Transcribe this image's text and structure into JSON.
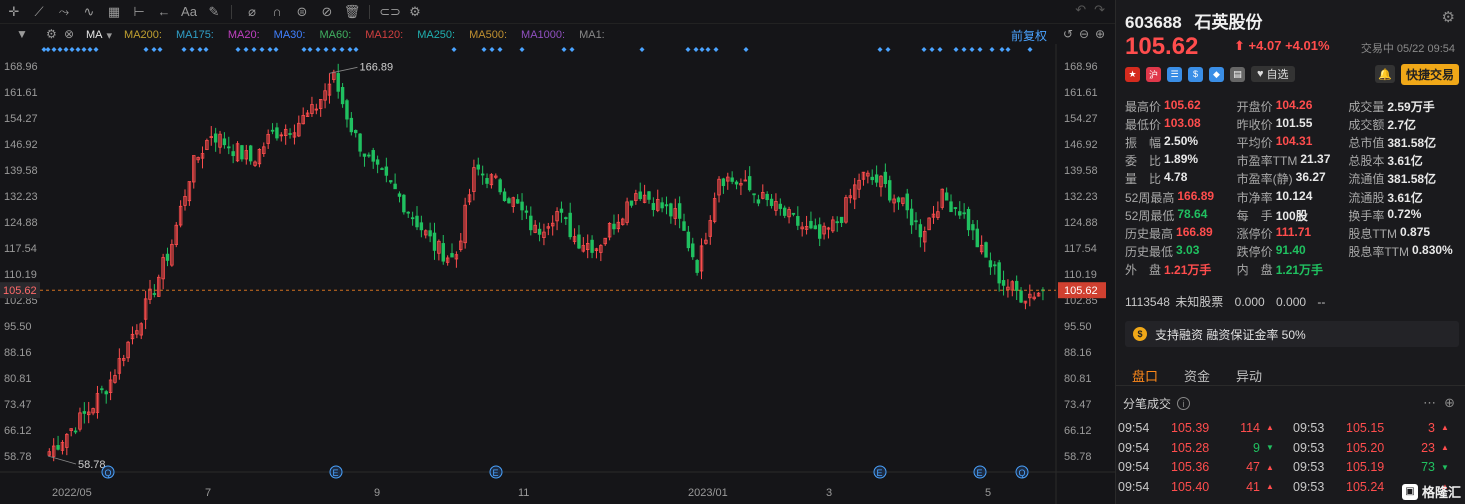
{
  "chart": {
    "fuquan_label": "前复权",
    "ma_selector": "MA",
    "ma_lines": [
      {
        "label": "MA200:",
        "color": "#c0a030"
      },
      {
        "label": "MA175:",
        "color": "#30a0c8"
      },
      {
        "label": "MA20:",
        "color": "#c040c0"
      },
      {
        "label": "MA30:",
        "color": "#4080ff"
      },
      {
        "label": "MA60:",
        "color": "#40b060"
      },
      {
        "label": "MA120:",
        "color": "#d04040"
      },
      {
        "label": "MA250:",
        "color": "#20b0b0"
      },
      {
        "label": "MA500:",
        "color": "#c09030"
      },
      {
        "label": "MA1000:",
        "color": "#9050c0"
      },
      {
        "label": "MA1:",
        "color": "#888888"
      }
    ],
    "y_ticks": [
      "168.96",
      "161.61",
      "154.27",
      "146.92",
      "139.58",
      "132.23",
      "124.88",
      "117.54",
      "110.19",
      "102.85",
      "95.50",
      "88.16",
      "80.81",
      "73.47",
      "66.12",
      "58.78"
    ],
    "current_price_tag": "105.62",
    "x_ticks": [
      "2022/05",
      "7",
      "9",
      "11",
      "2023/01",
      "3",
      "5"
    ],
    "high_label": "166.89",
    "low_label": "58.78",
    "event_markers": [
      "Q",
      "E",
      "E",
      "E",
      "E",
      "Q"
    ]
  },
  "chart_data": {
    "type": "candlestick",
    "ylim": [
      58.78,
      168.96
    ],
    "last_price": 105.62,
    "high": 166.89,
    "low": 58.78,
    "closes_weekly_approx": [
      60,
      66,
      72,
      80,
      92,
      104,
      118,
      140,
      150,
      146,
      142,
      150,
      152,
      156,
      166,
      150,
      140,
      134,
      126,
      118,
      114,
      140,
      136,
      130,
      122,
      128,
      120,
      118,
      126,
      134,
      130,
      126,
      112,
      138,
      136,
      132,
      128,
      124,
      120,
      126,
      138,
      136,
      130,
      122,
      132,
      128,
      116,
      108,
      104,
      105.62
    ]
  },
  "quote": {
    "code": "603688",
    "name": "石英股份",
    "price": "105.62",
    "arrow": "⬆",
    "change": "+4.07",
    "change_pct": "+4.01%",
    "time": "交易中 05/22 09:54",
    "watch_label": "自选",
    "quick_trade": "快捷交易",
    "badges": [
      {
        "text": "★",
        "color": "#d52b1e"
      },
      {
        "text": "沪",
        "color": "#e0384a"
      },
      {
        "text": "☰",
        "color": "#3a8ee6"
      },
      {
        "text": "$",
        "color": "#3a8ee6"
      },
      {
        "text": "◆",
        "color": "#3a8ee6"
      },
      {
        "text": "▤",
        "color": "#666666"
      }
    ]
  },
  "stats": [
    [
      {
        "l": "最高价",
        "v": "105.62",
        "c": "red"
      },
      {
        "l": "开盘价",
        "v": "104.26",
        "c": "red"
      },
      {
        "l": "成交量",
        "v": "2.59万手",
        "c": "white"
      }
    ],
    [
      {
        "l": "最低价",
        "v": "103.08",
        "c": "red"
      },
      {
        "l": "昨收价",
        "v": "101.55",
        "c": "white"
      },
      {
        "l": "成交额",
        "v": "2.7亿",
        "c": "white"
      }
    ],
    [
      {
        "l": "振　幅",
        "v": "2.50%",
        "c": "white"
      },
      {
        "l": "平均价",
        "v": "104.31",
        "c": "red"
      },
      {
        "l": "总市值",
        "v": "381.58亿",
        "c": "white"
      }
    ],
    [
      {
        "l": "委　比",
        "v": "1.89%",
        "c": "white"
      },
      {
        "l": "市盈率TTM",
        "v": "21.37",
        "c": "white"
      },
      {
        "l": "总股本",
        "v": "3.61亿",
        "c": "white"
      }
    ],
    [
      {
        "l": "量　比",
        "v": "4.78",
        "c": "white"
      },
      {
        "l": "市盈率(静)",
        "v": "36.27",
        "c": "white"
      },
      {
        "l": "流通值",
        "v": "381.58亿",
        "c": "white"
      }
    ],
    [
      {
        "l": "52周最高",
        "v": "166.89",
        "c": "red"
      },
      {
        "l": "市净率",
        "v": "10.124",
        "c": "white"
      },
      {
        "l": "流通股",
        "v": "3.61亿",
        "c": "white"
      }
    ],
    [
      {
        "l": "52周最低",
        "v": "78.64",
        "c": "green"
      },
      {
        "l": "每　手",
        "v": "100股",
        "c": "white"
      },
      {
        "l": "换手率",
        "v": "0.72%",
        "c": "white"
      }
    ],
    [
      {
        "l": "历史最高",
        "v": "166.89",
        "c": "red"
      },
      {
        "l": "涨停价",
        "v": "111.71",
        "c": "red"
      },
      {
        "l": "股息TTM",
        "v": "0.875",
        "c": "white"
      }
    ],
    [
      {
        "l": "历史最低",
        "v": "3.03",
        "c": "green"
      },
      {
        "l": "跌停价",
        "v": "91.40",
        "c": "green"
      },
      {
        "l": "股息率TTM",
        "v": "0.830%",
        "c": "white"
      }
    ],
    [
      {
        "l": "外　盘",
        "v": "1.21万手",
        "c": "red"
      },
      {
        "l": "内　盘",
        "v": "1.21万手",
        "c": "green"
      },
      {
        "l": "",
        "v": "",
        "c": "white"
      }
    ]
  ],
  "extra": {
    "id": "1113548",
    "name": "未知股票",
    "a": "0.000",
    "b": "0.000",
    "c": "--"
  },
  "margin": {
    "text": "支持融资 融资保证金率 50%",
    "coin": "$"
  },
  "tabs": [
    "盘口",
    "资金",
    "异动"
  ],
  "trades_title": "分笔成交",
  "trades": [
    {
      "t1": "09:54",
      "p1": "105.39",
      "v1": "114",
      "d1": "up",
      "t2": "09:53",
      "p2": "105.15",
      "v2": "3",
      "d2": "up"
    },
    {
      "t1": "09:54",
      "p1": "105.28",
      "v1": "9",
      "d1": "down",
      "t2": "09:53",
      "p2": "105.20",
      "v2": "23",
      "d2": "up"
    },
    {
      "t1": "09:54",
      "p1": "105.36",
      "v1": "47",
      "d1": "up",
      "t2": "09:53",
      "p2": "105.19",
      "v2": "73",
      "d2": "down"
    },
    {
      "t1": "09:54",
      "p1": "105.40",
      "v1": "41",
      "d1": "up",
      "t2": "09:53",
      "p2": "105.24",
      "v2": "",
      "d2": "up"
    }
  ],
  "logo": "格隆汇"
}
